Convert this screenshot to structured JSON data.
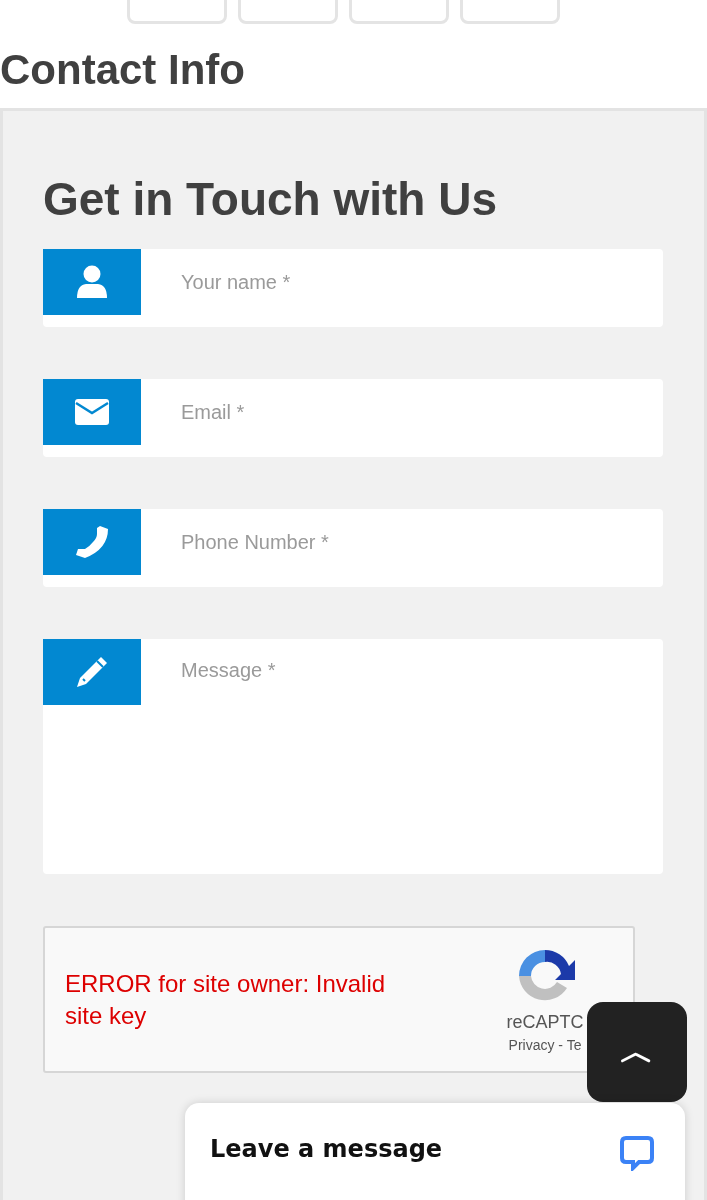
{
  "heading": "Contact Info",
  "form": {
    "title": "Get in Touch with Us",
    "fields": [
      {
        "kind": "person",
        "placeholder": "Your name *"
      },
      {
        "kind": "envelope",
        "placeholder": "Email *"
      },
      {
        "kind": "phone",
        "placeholder": "Phone Number *"
      },
      {
        "kind": "pencil",
        "placeholder": "Message *",
        "multiline": true
      }
    ],
    "captcha": {
      "error": "ERROR for site owner: Invalid site key",
      "brand": "reCAPTC",
      "links": "Privacy - Te"
    }
  },
  "scroll_top": {
    "label": "︿"
  },
  "chat": {
    "label": "Leave a message"
  }
}
